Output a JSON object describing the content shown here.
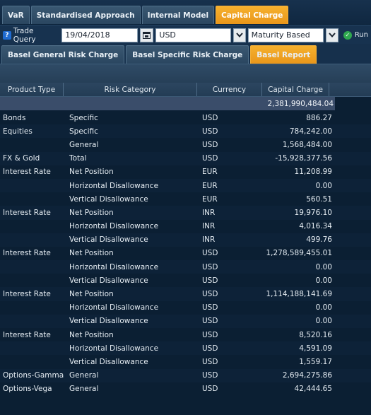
{
  "top_tabs": [
    {
      "label": "VaR",
      "active": false
    },
    {
      "label": "Standardised Approach",
      "active": false
    },
    {
      "label": "Internal Model",
      "active": false
    },
    {
      "label": "Capital Charge",
      "active": true
    }
  ],
  "toolbar": {
    "trade_query_label": "Trade Query",
    "date_value": "19/04/2018",
    "currency_value": "USD",
    "mode_value": "Maturity Based",
    "run_label": "Run"
  },
  "sub_tabs": [
    {
      "label": "Basel General Risk Charge",
      "active": false
    },
    {
      "label": "Basel Specific Risk Charge",
      "active": false
    },
    {
      "label": "Basel Report",
      "active": true
    }
  ],
  "table": {
    "headers": [
      "Product Type",
      "Risk Category",
      "Currency",
      "Capital Charge"
    ],
    "total": "2,381,990,484.04",
    "rows": [
      [
        "Bonds",
        "Specific",
        "USD",
        "886.27"
      ],
      [
        "Equities",
        "Specific",
        "USD",
        "784,242.00"
      ],
      [
        "",
        "General",
        "USD",
        "1,568,484.00"
      ],
      [
        "FX & Gold",
        "Total",
        "USD",
        "-15,928,377.56"
      ],
      [
        "Interest Rate",
        "Net Position",
        "EUR",
        "11,208.99"
      ],
      [
        "",
        "Horizontal Disallowance",
        "EUR",
        "0.00"
      ],
      [
        "",
        "Vertical Disallowance",
        "EUR",
        "560.51"
      ],
      [
        "Interest Rate",
        "Net Position",
        "INR",
        "19,976.10"
      ],
      [
        "",
        "Horizontal Disallowance",
        "INR",
        "4,016.34"
      ],
      [
        "",
        "Vertical Disallowance",
        "INR",
        "499.76"
      ],
      [
        "Interest Rate",
        "Net Position",
        "USD",
        "1,278,589,455.01"
      ],
      [
        "",
        "Horizontal Disallowance",
        "USD",
        "0.00"
      ],
      [
        "",
        "Vertical Disallowance",
        "USD",
        "0.00"
      ],
      [
        "Interest Rate",
        "Net Position",
        "USD",
        "1,114,188,141.69"
      ],
      [
        "",
        "Horizontal Disallowance",
        "USD",
        "0.00"
      ],
      [
        "",
        "Vertical Disallowance",
        "USD",
        "0.00"
      ],
      [
        "Interest Rate",
        "Net Position",
        "USD",
        "8,520.16"
      ],
      [
        "",
        "Horizontal Disallowance",
        "USD",
        "4,591.09"
      ],
      [
        "",
        "Vertical Disallowance",
        "USD",
        "1,559.17"
      ],
      [
        "Options-Gamma",
        "General",
        "USD",
        "2,694,275.86"
      ],
      [
        "Options-Vega",
        "General",
        "USD",
        "42,444.65"
      ]
    ]
  },
  "colors": {
    "accent": "#f0a020",
    "background": "#0b1f33",
    "total_row": "#3a4d6a"
  }
}
